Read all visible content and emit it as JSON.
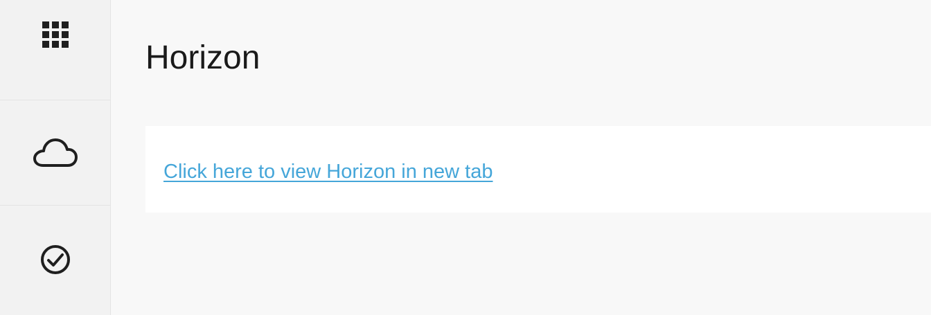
{
  "sidebar": {
    "items": [
      {
        "name": "apps",
        "icon": "grid-icon"
      },
      {
        "name": "cloud",
        "icon": "cloud-icon"
      },
      {
        "name": "tasks",
        "icon": "check-circle-icon"
      }
    ]
  },
  "main": {
    "title": "Horizon",
    "link_text": "Click here to view Horizon in new tab"
  },
  "colors": {
    "link": "#45a6d9",
    "sidebar_bg": "#f2f2f2",
    "page_bg": "#f8f8f8",
    "card_bg": "#ffffff"
  }
}
